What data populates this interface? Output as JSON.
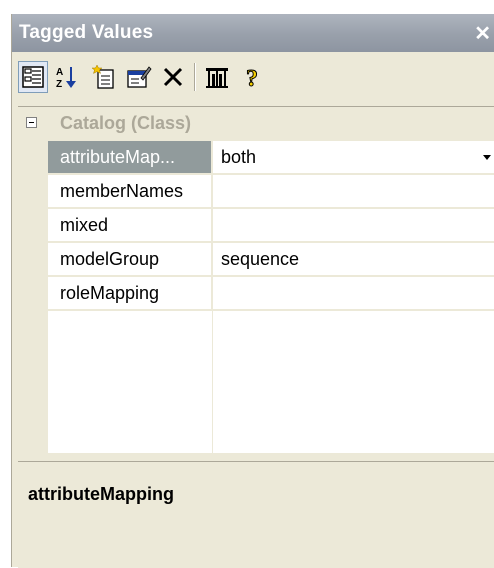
{
  "window": {
    "title": "Tagged Values",
    "close_glyph": "✕"
  },
  "toolbar": {
    "buttons": [
      {
        "name": "categorized-icon",
        "active": true
      },
      {
        "name": "sort-alphabetical-icon",
        "active": false
      },
      {
        "name": "new-tag-icon",
        "active": false
      },
      {
        "name": "edit-properties-icon",
        "active": false
      },
      {
        "name": "delete-icon",
        "active": false
      },
      {
        "name": "inherited-tags-icon",
        "active": false
      },
      {
        "name": "help-icon",
        "active": false
      }
    ]
  },
  "grid": {
    "category": {
      "label": "Catalog (Class)",
      "expanded": true
    },
    "rows": [
      {
        "name": "attributeMap...",
        "value": "both",
        "selected": true,
        "has_dropdown": true
      },
      {
        "name": "memberNames",
        "value": "",
        "selected": false,
        "has_dropdown": false
      },
      {
        "name": "mixed",
        "value": "",
        "selected": false,
        "has_dropdown": false
      },
      {
        "name": "modelGroup",
        "value": "sequence",
        "selected": false,
        "has_dropdown": false
      },
      {
        "name": "roleMapping",
        "value": "",
        "selected": false,
        "has_dropdown": false
      }
    ]
  },
  "description": {
    "title": "attributeMapping"
  },
  "colors": {
    "titlebar": "#99a0ab",
    "panel_bg": "#ece9d8",
    "selected_row": "#919b9c",
    "category_text": "#aca899"
  }
}
